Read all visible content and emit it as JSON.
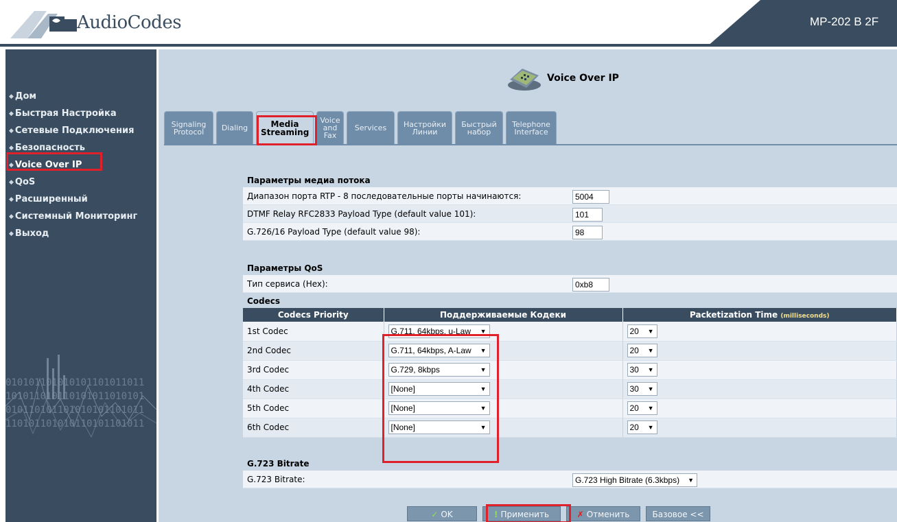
{
  "header": {
    "logo_text": "AudioCodes",
    "device_name": "MP-202 B 2F"
  },
  "sidebar": {
    "items": [
      {
        "label": "Дом"
      },
      {
        "label": "Быстрая Настройка"
      },
      {
        "label": "Сетевые Подключения"
      },
      {
        "label": "Безопасность"
      },
      {
        "label": "Voice Over IP"
      },
      {
        "label": "QoS"
      },
      {
        "label": "Расширенный"
      },
      {
        "label": "Системный Мониторинг"
      },
      {
        "label": "Выход"
      }
    ],
    "binary_art": [
      "010101101010101101011011",
      "101011010110101011010101",
      "010110101101010101101011",
      "110101101010110101101011"
    ]
  },
  "main": {
    "section_title": "Voice Over IP",
    "tabs": [
      {
        "line1": "Signaling",
        "line2": "Protocol",
        "line3": ""
      },
      {
        "line1": "Dialing",
        "line2": "",
        "line3": ""
      },
      {
        "line1": "Media",
        "line2": "Streaming",
        "line3": ""
      },
      {
        "line1": "Voice",
        "line2": "and",
        "line3": "Fax"
      },
      {
        "line1": "Services",
        "line2": "",
        "line3": ""
      },
      {
        "line1": "Настройки",
        "line2": "Линии",
        "line3": ""
      },
      {
        "line1": "Быстрый",
        "line2": "набор",
        "line3": ""
      },
      {
        "line1": "Telephone",
        "line2": "Interface",
        "line3": ""
      }
    ],
    "media_stream": {
      "title": "Параметры медиа потока",
      "rtp_label": "Диапазон порта RTP - 8 последовательные порты начинаются:",
      "rtp_value": "5004",
      "dtmf_label": "DTMF Relay RFC2833 Payload Type (default value 101):",
      "dtmf_value": "101",
      "g726_label": "G.726/16 Payload Type (default value 98):",
      "g726_value": "98"
    },
    "qos": {
      "title": "Параметры QoS",
      "tos_label": "Тип сервиса (Hex):",
      "tos_value": "0xb8"
    },
    "codecs": {
      "title": "Codecs",
      "headers": {
        "priority": "Codecs Priority",
        "supported": "Поддерживаемые Кодеки",
        "ptime": "Packetization Time",
        "ptime_unit": "(milliseconds)"
      },
      "rows": [
        {
          "priority": "1st Codec",
          "codec": "G.711, 64kbps, u-Law",
          "ptime": "20"
        },
        {
          "priority": "2nd Codec",
          "codec": "G.711, 64kbps, A-Law",
          "ptime": "20"
        },
        {
          "priority": "3rd Codec",
          "codec": "G.729, 8kbps",
          "ptime": "30"
        },
        {
          "priority": "4th Codec",
          "codec": "[None]",
          "ptime": "30"
        },
        {
          "priority": "5th Codec",
          "codec": "[None]",
          "ptime": "20"
        },
        {
          "priority": "6th Codec",
          "codec": "[None]",
          "ptime": "20"
        }
      ]
    },
    "g723": {
      "title": "G.723 Bitrate",
      "label": "G.723 Bitrate:",
      "value": "G.723 High Bitrate (6.3kbps)"
    },
    "buttons": {
      "ok": "OK",
      "apply": "Применить",
      "cancel": "Отменить",
      "basic": "Базовое <<"
    }
  },
  "colors": {
    "sidebar_bg": "#3a4d60",
    "content_bg": "#c8d6e4",
    "highlight": "#e0202a",
    "tab_bg": "#6f8ca8"
  }
}
